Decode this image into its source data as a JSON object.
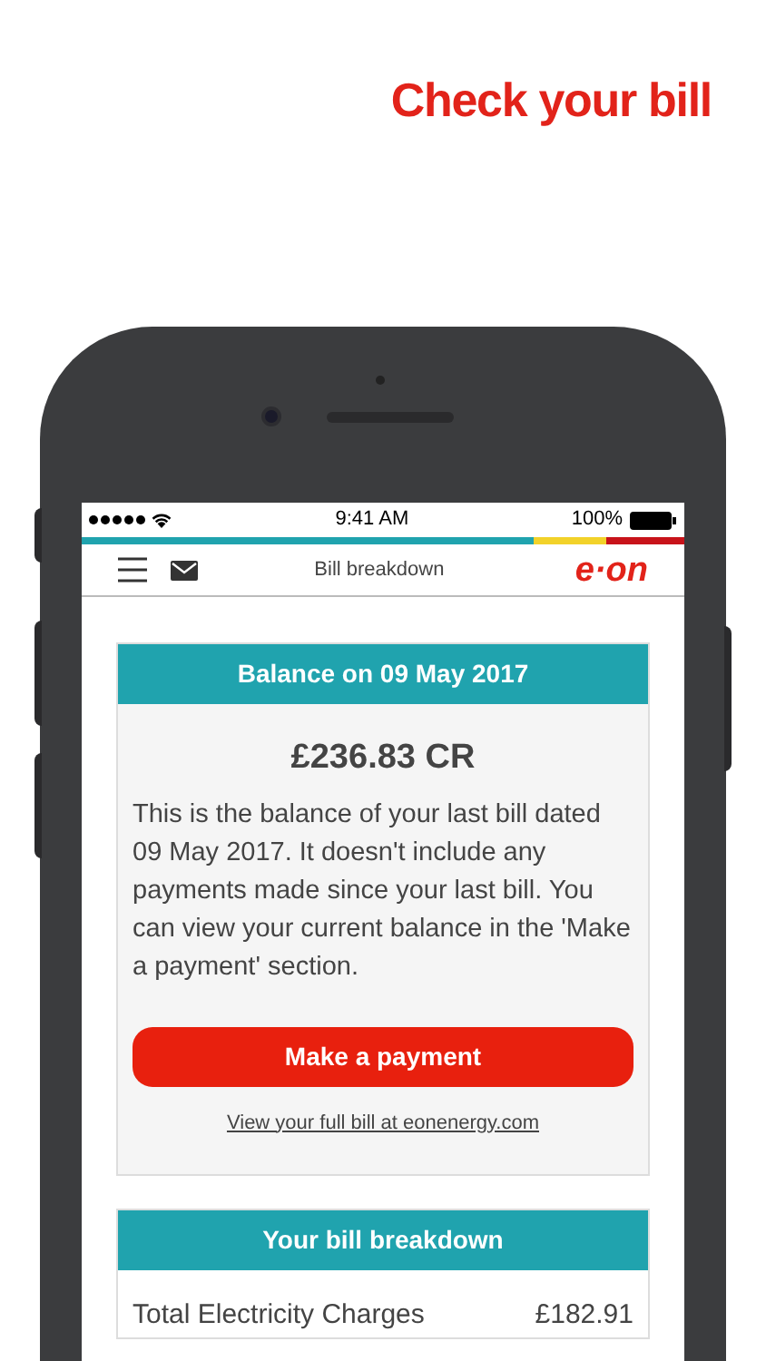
{
  "headline": "Check your bill",
  "status_bar": {
    "time": "9:41 AM",
    "battery": "100%"
  },
  "nav": {
    "title": "Bill breakdown",
    "logo": "e·on"
  },
  "balance_card": {
    "title": "Balance on 09 May 2017",
    "amount": "£236.83 CR",
    "description": "This is the balance of your last bill dated 09 May 2017. It doesn't include any payments made since your last bill. You can view your current balance in the 'Make a payment' section.",
    "button": "Make a payment",
    "link": "View your full bill at eonenergy.com"
  },
  "breakdown_card": {
    "title": "Your bill breakdown",
    "rows": [
      {
        "label": "Total Electricity Charges",
        "value": "£182.91"
      }
    ]
  }
}
